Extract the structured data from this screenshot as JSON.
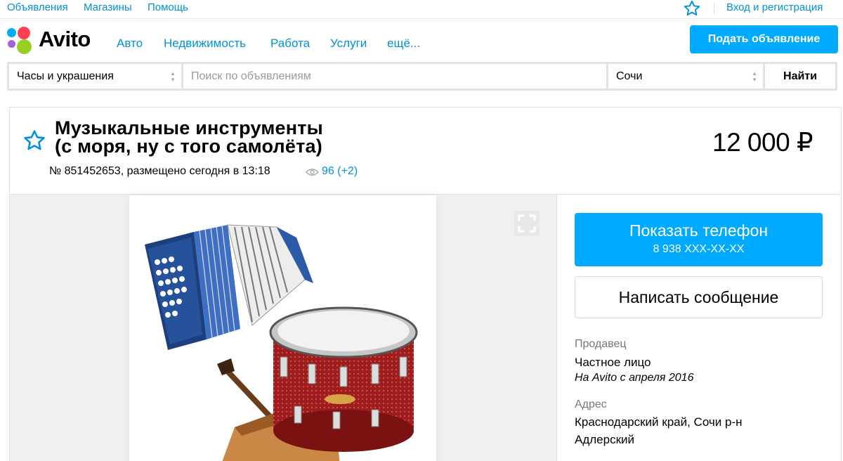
{
  "top_nav": {
    "ads": "Объявления",
    "shops": "Магазины",
    "help": "Помощь",
    "login": "Вход и регистрация"
  },
  "header": {
    "logo_text": "Avito",
    "nav": [
      "Авто",
      "Недвижимость",
      "Работа",
      "Услуги",
      "ещё..."
    ],
    "post_button": "Подать объявление"
  },
  "search": {
    "category": "Часы и украшения",
    "placeholder": "Поиск по объявлениям",
    "city": "Сочи",
    "find_button": "Найти"
  },
  "listing": {
    "title_line1": "Музыкальные инструменты",
    "title_line2": "(с моря, ну с того самолёта)",
    "price": "12 000 ₽",
    "meta": "№ 851452653, размещено сегодня в 13:18",
    "views": "96 (+2)"
  },
  "contact": {
    "show_phone": "Показать телефон",
    "phone_masked": "8 938 XXX-XX-XX",
    "write_message": "Написать сообщение"
  },
  "seller": {
    "label": "Продавец",
    "name": "Частное лицо",
    "since": "На Avito с апреля 2016"
  },
  "address": {
    "label": "Адрес",
    "line1": "Краснодарский край, Сочи р-н",
    "line2": "Адлерский"
  },
  "colors": {
    "accent": "#00aaff",
    "link": "#0091d9"
  },
  "icons": {
    "favorite": "star-icon",
    "views": "eye-icon",
    "expand": "expand-icon"
  }
}
